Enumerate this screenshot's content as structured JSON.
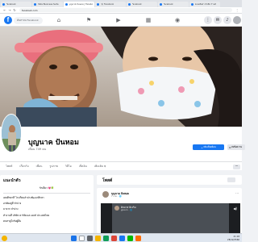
{
  "browser": {
    "tabs": [
      {
        "label": "Facebook",
        "active": false
      },
      {
        "label": "Meta Business Suite",
        "active": false
      },
      {
        "label": "บุญนาค ปันหอม | Facebook",
        "active": true
      },
      {
        "label": "(1) Facebook",
        "active": false
      },
      {
        "label": "Facebook",
        "active": false
      },
      {
        "label": "Facebook",
        "active": false
      },
      {
        "label": "ซ่อมเสื้อผ้า ปักชื่อ ร้านบี",
        "active": false
      }
    ],
    "url": "facebook.com"
  },
  "fb_nav": {
    "logo": "f",
    "search_placeholder": "ค้นหาบน Facebook",
    "icons": [
      "home-icon",
      "flag-icon",
      "video-icon",
      "store-icon",
      "gaming-icon"
    ]
  },
  "profile": {
    "name": "บุญนาค ปันหอม",
    "friends": "เพื่อน 749 คน",
    "add_friend_label": "เพิ่มเป็นเพื่อน",
    "message_label": "ส่งข้อความ"
  },
  "profile_tabs": [
    "โพสต์",
    "เกี่ยวกับ",
    "เพื่อน",
    "รูปภาพ",
    "วิดีโอ",
    "เช็คอิน",
    "เพิ่มเติม"
  ],
  "intro": {
    "heading": "แนะนำตัว",
    "bio": "รักเดียว 💗🍀",
    "lines": [
      "เคยศึกษาที่ โรงเรียนลำปางพัฒนาศึกษา",
      "อาศัยอยู่ที่ ลำปาง",
      "มาจาก ลำปาง",
      "ทำงานที่ บริษัท คาร์ดิแนล เฮลท์ ประเทศไทย",
      "คบหาดูใจกับผู้อื่น"
    ]
  },
  "posts": {
    "heading": "โพสต์",
    "post": {
      "author": "บุญนาค ปันหอม",
      "meta": "7 ธ.ค. · 🌐",
      "video_title": "ดิลมาส คิเจริม",
      "video_meta": "ดูต่อแล้ว · 🌐"
    }
  },
  "taskbar": {
    "time": "21:18",
    "date": "28/12/2566"
  },
  "colors": {
    "fb_blue": "#1877f2",
    "page_bg": "#f0f2f5"
  }
}
